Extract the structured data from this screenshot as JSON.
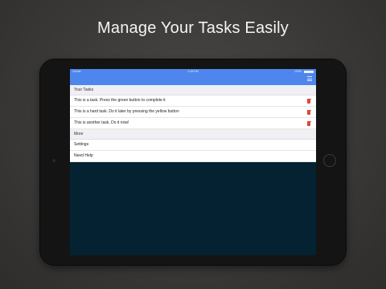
{
  "headline": "Manage Your Tasks Easily",
  "status_bar": {
    "carrier": "Carrier",
    "time": "2:18 PM",
    "battery": "100%"
  },
  "sections": {
    "tasks_header": "Your Tasks",
    "more_header": "More"
  },
  "tasks": [
    "This is a task. Press the green button to complete it",
    "This is a hard task. Do it later by pressing the yellow button",
    "This is another task. Do it now!"
  ],
  "more_items": [
    "Settings",
    "Need Help"
  ],
  "colors": {
    "nav_blue": "#4e86ee",
    "delete_red": "#e2453a",
    "screen_background": "#042231"
  },
  "icons": {
    "menu": "menu-icon",
    "delete": "trash-icon"
  }
}
